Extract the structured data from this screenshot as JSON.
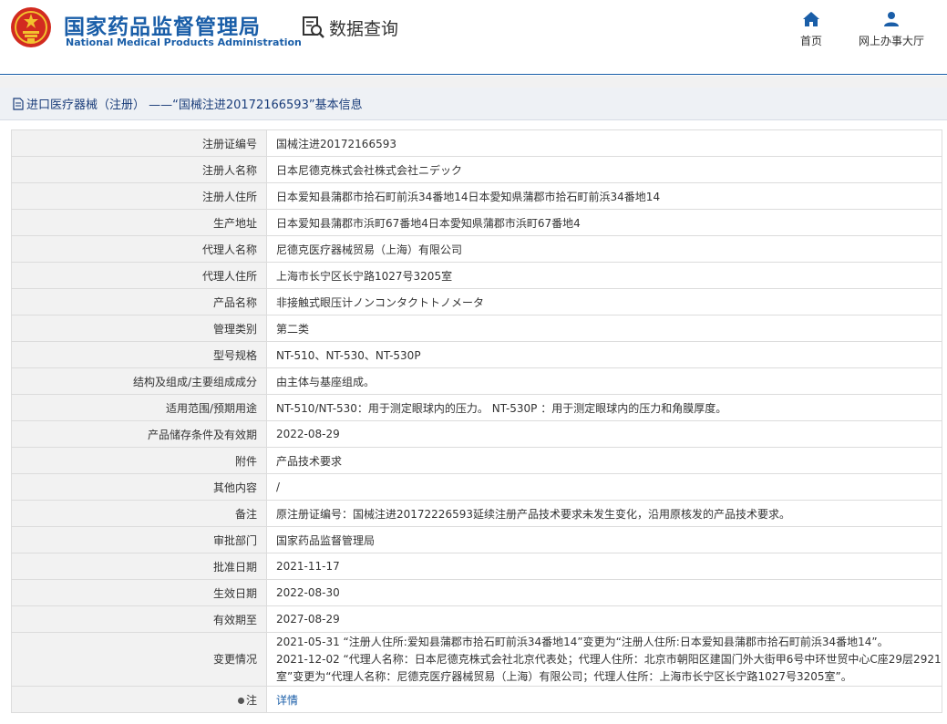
{
  "header": {
    "brand_cn": "国家药品监督管理局",
    "brand_en": "National Medical Products Administration",
    "query_label": "数据查询",
    "nav": [
      {
        "label": "首页",
        "icon": "home-icon"
      },
      {
        "label": "网上办事大厅",
        "icon": "user-icon"
      }
    ],
    "accent_color": "#1a5ea8"
  },
  "page_title": "进口医疗器械（注册） ——“国械注进20172166593”基本信息",
  "records": [
    {
      "label": "注册证编号",
      "value": "国械注进20172166593"
    },
    {
      "label": "注册人名称",
      "value": "日本尼德克株式会社株式会社ニデック"
    },
    {
      "label": "注册人住所",
      "value": "日本爱知县蒲郡市拾石町前浜34番地14日本愛知県蒲郡市拾石町前浜34番地14"
    },
    {
      "label": "生产地址",
      "value": "日本爱知县蒲郡市浜町67番地4日本愛知県蒲郡市浜町67番地4"
    },
    {
      "label": "代理人名称",
      "value": "尼德克医疗器械贸易（上海）有限公司"
    },
    {
      "label": "代理人住所",
      "value": "上海市长宁区长宁路1027号3205室"
    },
    {
      "label": "产品名称",
      "value": "非接触式眼压计ノンコンタクトトノメータ"
    },
    {
      "label": "管理类别",
      "value": "第二类"
    },
    {
      "label": "型号规格",
      "value": "NT-510、NT-530、NT-530P"
    },
    {
      "label": "结构及组成/主要组成成分",
      "value": "由主体与基座组成。"
    },
    {
      "label": "适用范围/预期用途",
      "value": "NT-510/NT-530：用于测定眼球内的压力。 NT-530P ：用于测定眼球内的压力和角膜厚度。"
    },
    {
      "label": "产品储存条件及有效期",
      "value": "2022-08-29"
    },
    {
      "label": "附件",
      "value": "产品技术要求"
    },
    {
      "label": "其他内容",
      "value": "/"
    },
    {
      "label": "备注",
      "value": "原注册证编号：国械注进20172226593延续注册产品技术要求未发生变化，沿用原核发的产品技术要求。"
    },
    {
      "label": "审批部门",
      "value": "国家药品监督管理局"
    },
    {
      "label": "批准日期",
      "value": "2021-11-17"
    },
    {
      "label": "生效日期",
      "value": "2022-08-30"
    },
    {
      "label": "有效期至",
      "value": "2027-08-29"
    }
  ],
  "change_row": {
    "label": "变更情况",
    "line1": "2021-05-31 “注册人住所:爱知县蒲郡市拾石町前浜34番地14”变更为“注册人住所:日本爱知县蒲郡市拾石町前浜34番地14”。",
    "line2": "2021-12-02 “代理人名称：日本尼德克株式会社北京代表处；代理人住所：北京市朝阳区建国门外大街甲6号中环世贸中心C座29层2921室”变更为“代理人名称：尼德克医疗器械贸易（上海）有限公司；代理人住所：上海市长宁区长宁路1027号3205室”。"
  },
  "note_row": {
    "label": "注",
    "link": "详情"
  }
}
